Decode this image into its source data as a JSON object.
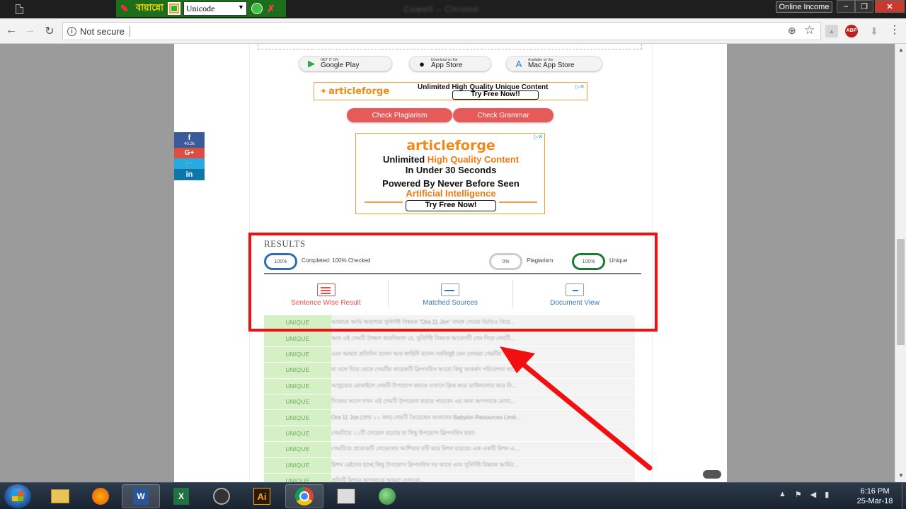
{
  "titlebar": {
    "avro_name": "বায়ান্নো",
    "keyboard_select": "Unicode",
    "window_title": "Cowell – Chrome",
    "online_income": "Online Income"
  },
  "browser": {
    "security_label": "Not secure",
    "url": ""
  },
  "stores": [
    {
      "small": "GET IT ON",
      "big": "Google Play"
    },
    {
      "small": "Download on the",
      "big": "App Store"
    },
    {
      "small": "Available on the",
      "big": "Mac App Store"
    }
  ],
  "ad_banner": {
    "logo": "articleforge",
    "headline": "Unlimited High Quality Unique Content",
    "cta": "Try Free Now!!"
  },
  "buttons": {
    "check_plagiarism": "Check Plagiarism",
    "check_grammar": "Check Grammar"
  },
  "social": {
    "facebook_count": "40.2k",
    "facebook_glyph": "f",
    "googleplus_glyph": "G+",
    "twitter_glyph": "🐦",
    "linkedin_glyph": "in"
  },
  "ad_box": {
    "logo": "articleforge",
    "line1_a": "Unlimited ",
    "line1_b": "High Quality Content",
    "line2": "In Under 30 Seconds",
    "line3": "Powered By Never Before Seen",
    "line4": "Artificial Intelligence",
    "cta": "Try Free Now!"
  },
  "results": {
    "title": "RESULTS",
    "completed_pct": "100%",
    "completed_label": "Completed: 100% Checked",
    "plagiarism_pct": "0%",
    "plagiarism_label": "Plagiarism",
    "unique_pct": "100%",
    "unique_label": "Unique",
    "tabs": [
      "Sentence Wise Result",
      "Matched Sources",
      "Document View"
    ],
    "rows": [
      {
        "status": "UNIQUE",
        "text": "আমাকে আমি অবশেষে সুনির্দিষ্ট বিষয়ক \"Ora 11 Jon\" নামক গেমের ভিডিও নিয়ে..."
      },
      {
        "status": "UNIQUE",
        "text": "আর এই গেমটি উজ্জল কারণিয়াল যে, সুনির্দিষ্ট বিষয়ক আবেগটি গেম নিয়ে গেমটি..."
      },
      {
        "status": "UNIQUE",
        "text": "এবং আমরা প্রতিদিন বলেন আর কাহিনী বলেন সবকিছুই যেন তোমরা গেমটির আন..."
      },
      {
        "status": "UNIQUE",
        "text": "না বলে দিয়ে থেকে গেমটির কারেকটি ক্লিপসবিস আরো কিছু আকর্ষণ পরিবেশনা থাকে।"
      },
      {
        "status": "UNIQUE",
        "text": "আন্ড্রয়েড মোবাইলে গেমটি উপভোগ করতে এখানে ক্লিক করে ডাউনলোড করে নি..."
      },
      {
        "status": "UNIQUE",
        "text": "নিজের আগে যখন এই গেমটি উপভোগ করতে পারবেন এর জন্য আপনাকে মোবা..."
      },
      {
        "status": "UNIQUE",
        "text": "Ora 11 Jon (প্রায় ১১ জন) গেমটি তৈরেছেন আমাদের Babylon Resources Limit..."
      },
      {
        "status": "UNIQUE",
        "text": "গেমটিতে ১১টি লেভেল রয়েছে যা কিছু উপভোগ ক্লিপসবিস ভরা।"
      },
      {
        "status": "UNIQUE",
        "text": "গেমটিতে প্রত্যেকটি লেভেলের আশিয়ার বটি করে মিশন রয়েছে। এক একটি মিশন এ..."
      },
      {
        "status": "UNIQUE",
        "text": "মিশন মেইনের হচ্ছে কিছু উপভোগ ক্লিপসবিস দর আনে এবং সুনির্দিষ্ট বিষয়ক আর্মির..."
      },
      {
        "status": "UNIQUE",
        "text": "প্রতিটি মিশনে আপনাকে আমরা দেখাবো..."
      }
    ]
  },
  "taskbar": {
    "word_label": "W",
    "excel_label": "X",
    "ai_label": "Ai",
    "time": "6:16 PM",
    "date": "25-Mar-18"
  },
  "colors": {
    "highlight_red": "#f20f0f",
    "unique_green": "#d4f0c4",
    "button_red": "#e75a5a"
  }
}
